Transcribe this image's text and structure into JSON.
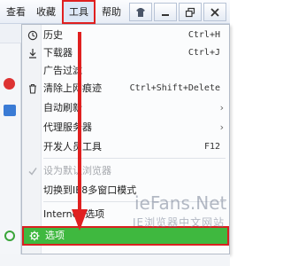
{
  "menubar": {
    "items": [
      {
        "label": "查看"
      },
      {
        "label": "收藏"
      },
      {
        "label": "工具"
      },
      {
        "label": "帮助"
      }
    ]
  },
  "window_buttons": {
    "shirt": "shirt-icon",
    "minimize": "minimize-icon",
    "restore": "restore-icon",
    "close": "close-icon"
  },
  "tools_menu": {
    "items": [
      {
        "label": "历史",
        "shortcut": "Ctrl+H",
        "icon": "history-icon"
      },
      {
        "label": "下载器",
        "shortcut": "Ctrl+J",
        "icon": "download-icon"
      },
      {
        "label": "广告过滤",
        "shortcut": "",
        "icon": ""
      },
      {
        "label": "清除上网痕迹",
        "shortcut": "Ctrl+Shift+Delete",
        "icon": "trash-icon"
      },
      {
        "label": "自动刷新",
        "submenu": true
      },
      {
        "label": "代理服务器",
        "submenu": true
      },
      {
        "label": "开发人员工具",
        "shortcut": "F12"
      },
      {
        "label": "设为默认浏览器",
        "disabled": true,
        "icon": "checkmark-icon"
      },
      {
        "label": "切换到IE8多窗口模式"
      },
      {
        "label": "Internet 选项"
      }
    ],
    "options": {
      "label": "选项",
      "icon": "gear-icon"
    }
  },
  "watermark": {
    "line1": "ieFans.Net",
    "line2": "IE浏览器中文网站"
  },
  "colors": {
    "highlight_border": "#e02020",
    "options_bg": "#3fb83f",
    "menubar_bg": "#e9eef6"
  }
}
